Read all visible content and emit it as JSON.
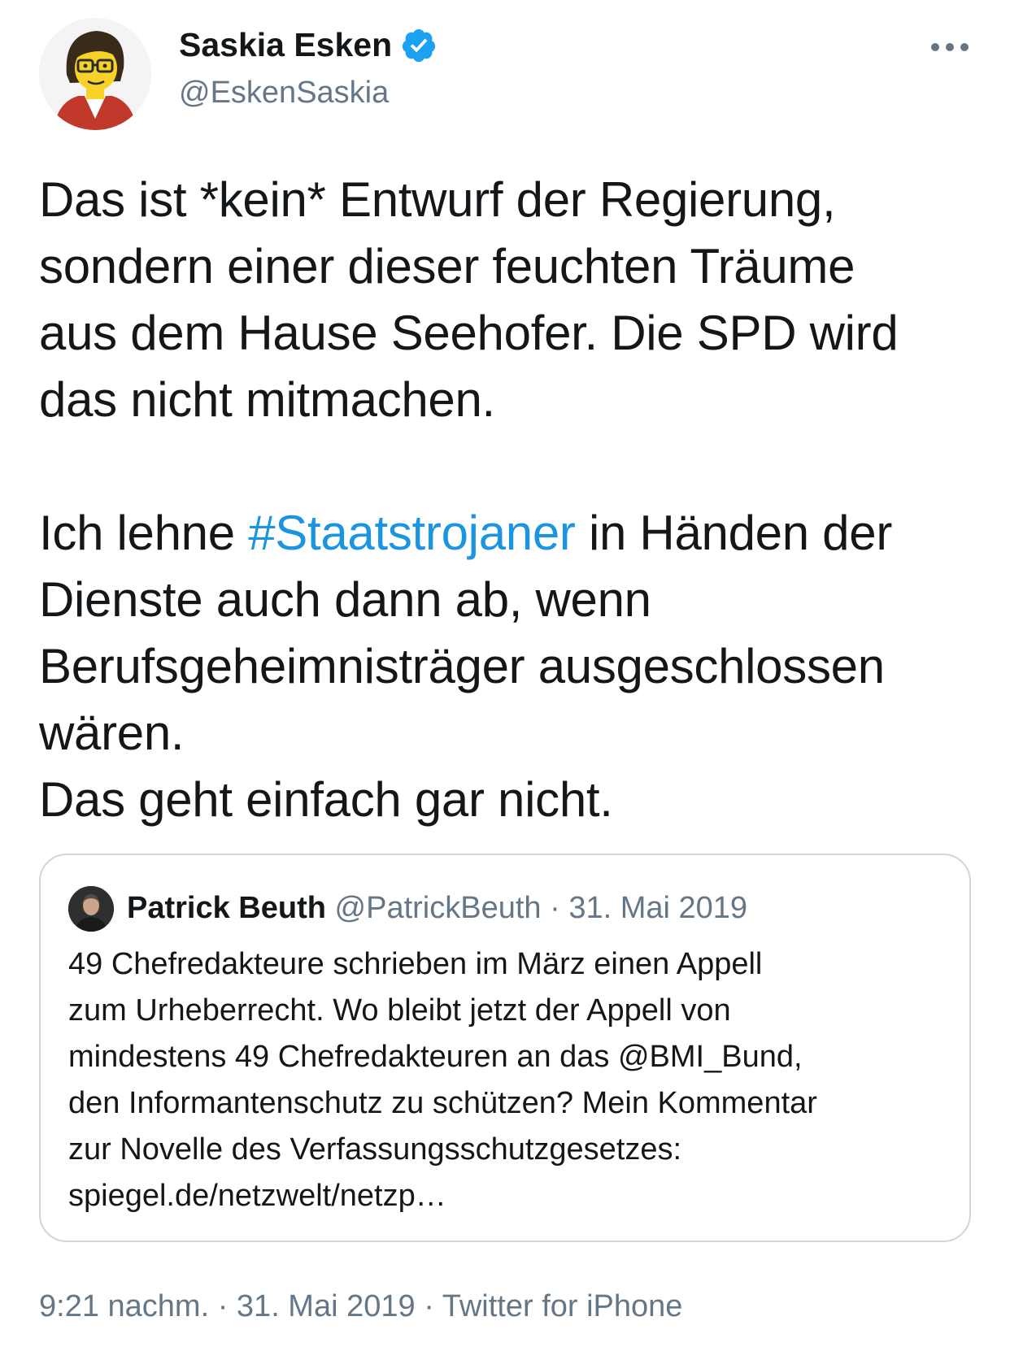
{
  "author": {
    "name": "Saskia Esken",
    "handle": "@EskenSaskia",
    "verified": true
  },
  "tweet": {
    "paragraph1": [
      "Das ist *kein* Entwurf der Regierung,",
      "sondern einer dieser feuchten Träume",
      "aus dem Hause Seehofer. Die SPD wird",
      "das nicht mitmachen."
    ],
    "paragraph2": {
      "line1_prefix": "Ich lehne ",
      "hashtag": "#Staatstrojaner",
      "line1_suffix": " in Händen der",
      "lines": [
        "Dienste auch dann ab, wenn",
        "Berufsgeheimnisträger ausgeschlossen",
        "wären.",
        "Das geht einfach gar nicht."
      ]
    }
  },
  "quoted_tweet": {
    "name": "Patrick Beuth",
    "handle": "@PatrickBeuth",
    "date": "31. Mai 2019",
    "separator": " · ",
    "lines": [
      "49 Chefredakteure schrieben im März einen Appell",
      "zum Urheberrecht. Wo bleibt jetzt der Appell von",
      "mindestens 49 Chefredakteuren an das @BMI_Bund,",
      "den Informantenschutz zu schützen? Mein Kommentar",
      "zur Novelle des Verfassungsschutzgesetzes:",
      "spiegel.de/netzwelt/netzp…"
    ]
  },
  "footer": {
    "time": "9:21 nachm.",
    "date": "31. Mai 2019",
    "source": "Twitter for iPhone",
    "separator": " · "
  },
  "colors": {
    "text": "#14171a",
    "secondary": "#657786",
    "link": "#1b95e0",
    "verified": "#1da1f2",
    "border": "#ccd6dd"
  },
  "icons": {
    "verified": "verified-badge-icon",
    "more": "more-options-icon"
  }
}
